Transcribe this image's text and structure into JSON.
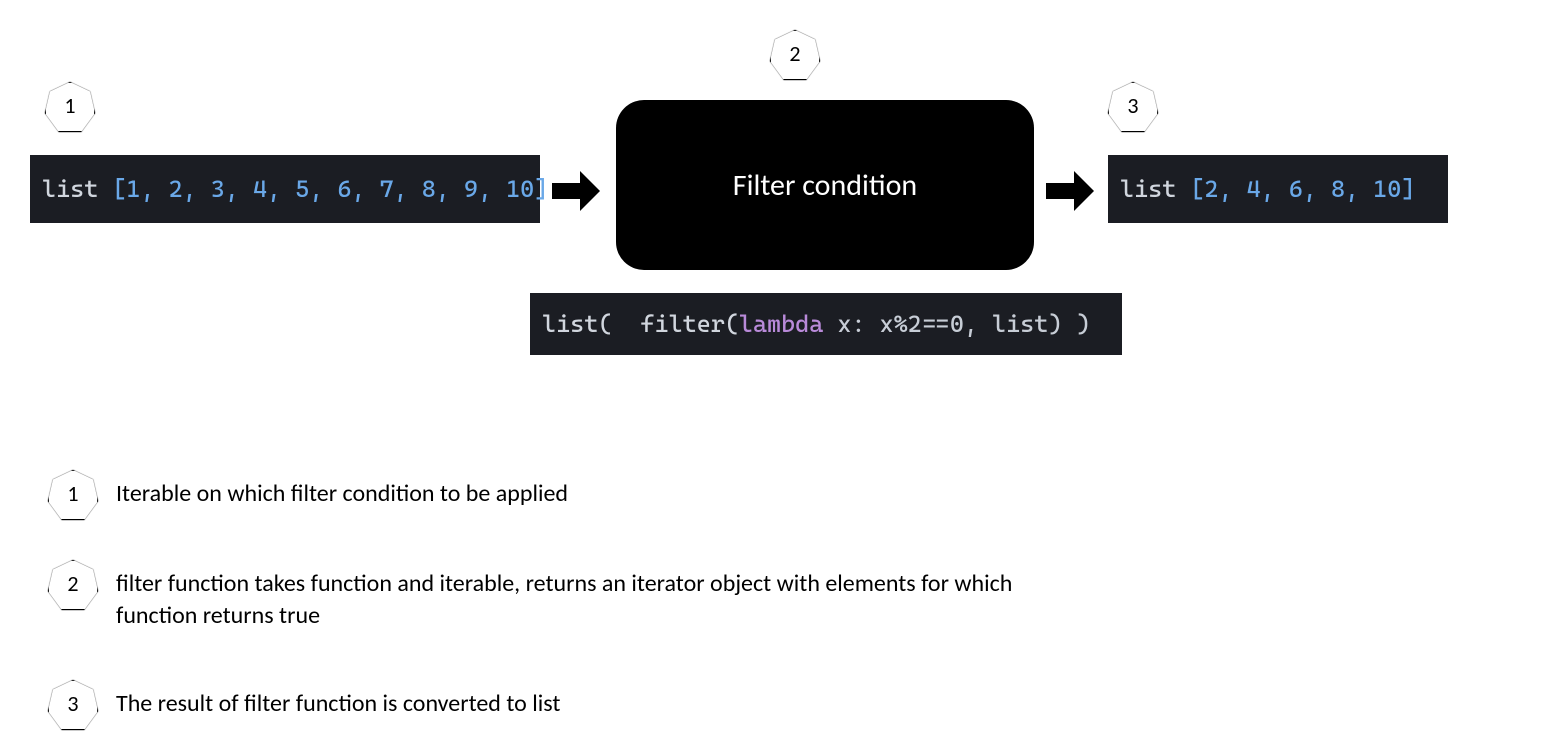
{
  "badges": {
    "one": "1",
    "two": "2",
    "three": "3"
  },
  "flow": {
    "input_list_prefix": "list ",
    "input_list_values": "[1, 2, 3, 4, 5, 6, 7, 8, 9, 10]",
    "filter_box_label": "Filter condition",
    "output_list_prefix": "list ",
    "output_list_values": "[2, 4, 6, 8, 10]"
  },
  "filter_code": {
    "p1": "list(  filter(",
    "lambda": "lambda",
    "p2": " x: x%2==0, list) )"
  },
  "legend": {
    "one": "Iterable on which filter condition to be applied",
    "two": "filter function takes function and iterable, returns an iterator object with elements for which function returns true",
    "three": "The result of filter function is converted to list"
  }
}
